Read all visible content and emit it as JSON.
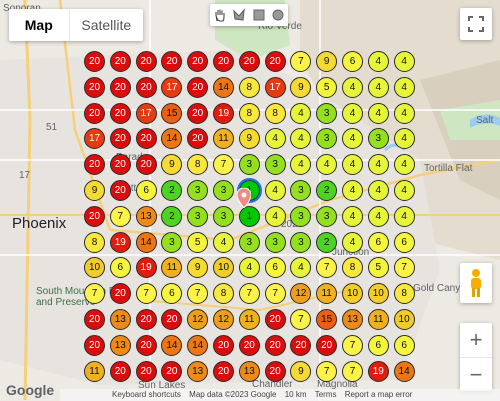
{
  "map_controls": {
    "map_label": "Map",
    "satellite_label": "Satellite",
    "active_type": "Map"
  },
  "places": {
    "phoenix": "Phoenix",
    "sonoran": "Sonoran",
    "rio_verde": "Rio Verde",
    "tortilla_flat": "Tortilla Flat",
    "south_mountain": "South Mountain Park and Preserve",
    "gold_canyon": "Gold Canyon",
    "junction": "Junction",
    "sun_lakes": "Sun Lakes",
    "chandler": "Chandler",
    "magnolia": "Magnolia",
    "salt": "Salt",
    "parad": "Parad",
    "cott": "Cott",
    "route_51": "51",
    "route_17": "17",
    "route_202": "202"
  },
  "footer": {
    "logo": "Google",
    "keyboard_shortcuts": "Keyboard shortcuts",
    "map_data": "Map data ©2023 Google",
    "scale": "10 km",
    "terms": "Terms",
    "report": "Report a map error"
  },
  "icons": {
    "hand": "hand-icon",
    "polygon": "polygon-icon",
    "square": "square-icon",
    "circle": "circle-icon",
    "fullscreen": "fullscreen-icon",
    "pegman": "pegman-icon",
    "zoom_in": "zoom-in-icon",
    "zoom_out": "zoom-out-icon",
    "location": "location-pin-icon"
  },
  "heatmap": {
    "rows": [
      [
        20,
        20,
        20,
        20,
        20,
        20,
        20,
        20,
        7,
        9,
        6,
        4,
        4
      ],
      [
        20,
        20,
        20,
        17,
        20,
        14,
        8,
        17,
        9,
        5,
        4,
        4,
        4
      ],
      [
        20,
        20,
        17,
        15,
        20,
        19,
        8,
        8,
        4,
        3,
        4,
        4,
        4
      ],
      [
        17,
        20,
        20,
        14,
        20,
        11,
        9,
        4,
        4,
        3,
        4,
        3,
        4
      ],
      [
        20,
        20,
        20,
        9,
        8,
        7,
        3,
        3,
        4,
        4,
        4,
        4,
        4
      ],
      [
        9,
        20,
        6,
        2,
        3,
        3,
        1,
        4,
        3,
        2,
        4,
        4,
        4
      ],
      [
        20,
        7,
        13,
        2,
        3,
        3,
        1,
        4,
        3,
        3,
        4,
        4,
        4
      ],
      [
        8,
        19,
        14,
        3,
        5,
        4,
        3,
        3,
        3,
        2,
        4,
        6,
        6
      ],
      [
        10,
        6,
        19,
        11,
        9,
        10,
        4,
        6,
        4,
        7,
        8,
        5,
        7
      ],
      [
        7,
        20,
        7,
        6,
        7,
        8,
        7,
        7,
        12,
        11,
        10,
        10,
        8
      ],
      [
        20,
        13,
        20,
        20,
        12,
        12,
        11,
        20,
        7,
        15,
        13,
        11,
        10
      ],
      [
        20,
        13,
        20,
        14,
        14,
        20,
        20,
        20,
        20,
        20,
        7,
        6,
        6
      ],
      [
        11,
        20,
        20,
        20,
        13,
        20,
        13,
        20,
        9,
        7,
        7,
        19,
        14
      ]
    ],
    "selected": [
      5,
      6
    ],
    "colors": {
      "1": "#00c800",
      "2": "#4dd420",
      "3": "#94e01e",
      "4": "#e6f53a",
      "5": "#f2f53c",
      "6": "#f5f53c",
      "7": "#fbf347",
      "8": "#f8e83c",
      "9": "#f5da32",
      "10": "#f2cc28",
      "11": "#f0b020",
      "12": "#ef9e1c",
      "13": "#ee8a18",
      "14": "#ec7614",
      "15": "#ea6010",
      "17": "#e63a10",
      "19": "#e11c0c",
      "20": "#dc0c0c"
    }
  }
}
